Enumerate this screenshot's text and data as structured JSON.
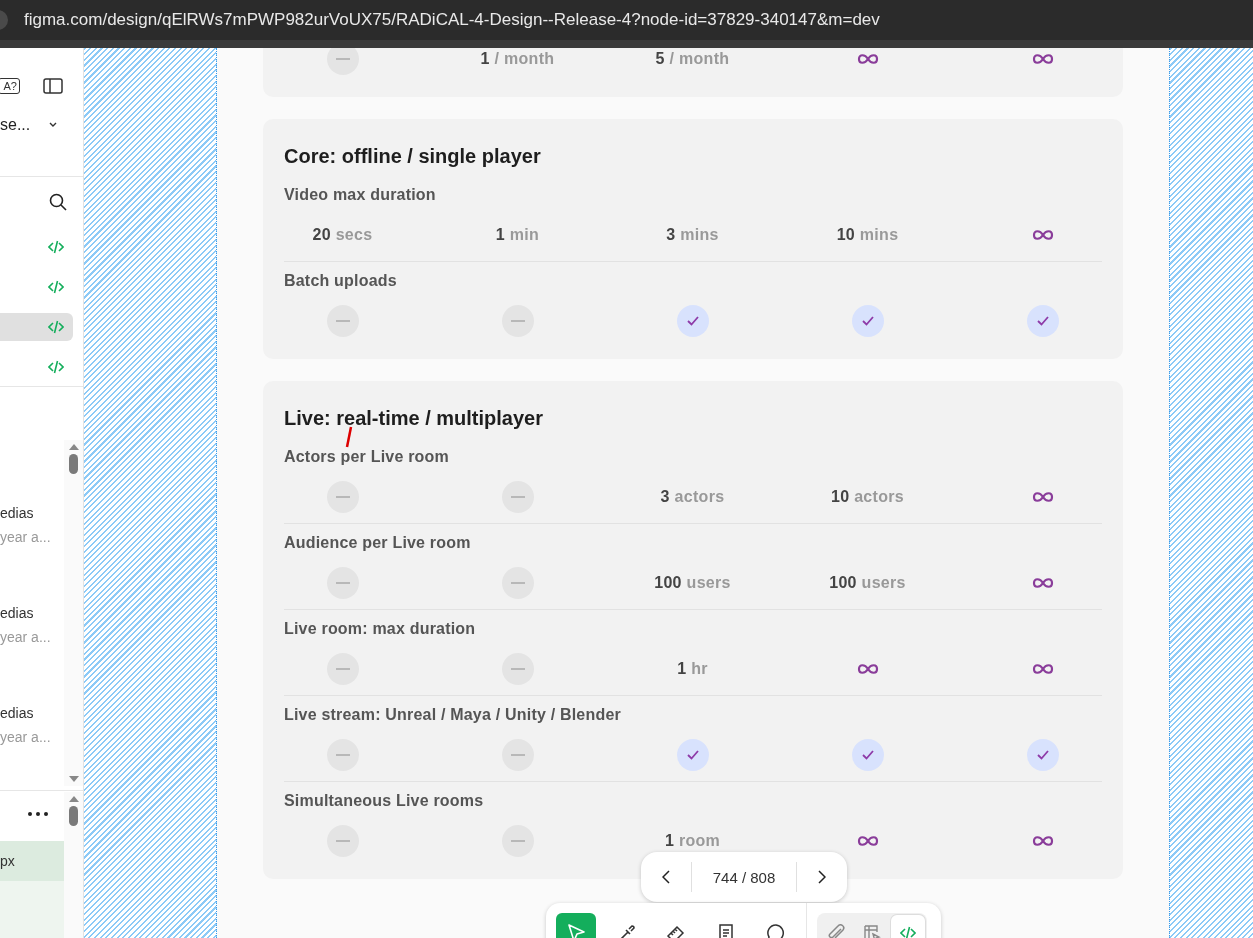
{
  "browser": {
    "url": "figma.com/design/qElRWs7mPWP982urVoUX75/RADiCAL-4-Design--Release-4?node-id=37829-340147&m=dev"
  },
  "sidebar": {
    "badge": "A?",
    "file_name": "se...",
    "code_items": [
      {
        "selected": false
      },
      {
        "selected": false
      },
      {
        "selected": true
      },
      {
        "selected": false
      }
    ],
    "list_items": [
      {
        "title": "edias",
        "subtitle": "year a..."
      },
      {
        "title": "edias",
        "subtitle": "year a..."
      },
      {
        "title": "edias",
        "subtitle": "year a..."
      }
    ],
    "property_value": "px"
  },
  "sections": [
    {
      "rows": [
        {
          "cells": [
            {
              "kind": "none"
            },
            {
              "kind": "text",
              "value": "1",
              "unit": "/ month"
            },
            {
              "kind": "text",
              "value": "5",
              "unit": "/ month"
            },
            {
              "kind": "unlimited"
            },
            {
              "kind": "unlimited"
            }
          ]
        }
      ]
    },
    {
      "title": "Core: offline / single player",
      "rows": [
        {
          "label": "Video max duration",
          "cells": [
            {
              "kind": "text",
              "value": "20",
              "unit": "secs"
            },
            {
              "kind": "text",
              "value": "1",
              "unit": "min"
            },
            {
              "kind": "text",
              "value": "3",
              "unit": "mins"
            },
            {
              "kind": "text",
              "value": "10",
              "unit": "mins"
            },
            {
              "kind": "unlimited"
            }
          ]
        },
        {
          "label": "Batch uploads",
          "cells": [
            {
              "kind": "none"
            },
            {
              "kind": "none"
            },
            {
              "kind": "check"
            },
            {
              "kind": "check"
            },
            {
              "kind": "check"
            }
          ]
        }
      ]
    },
    {
      "title": "Live: real-time / multiplayer",
      "rows": [
        {
          "label": "Actors per Live room",
          "cells": [
            {
              "kind": "none"
            },
            {
              "kind": "none"
            },
            {
              "kind": "text",
              "value": "3",
              "unit": "actors"
            },
            {
              "kind": "text",
              "value": "10",
              "unit": "actors"
            },
            {
              "kind": "unlimited"
            }
          ]
        },
        {
          "label": "Audience per Live room",
          "cells": [
            {
              "kind": "none"
            },
            {
              "kind": "none"
            },
            {
              "kind": "text",
              "value": "100",
              "unit": "users"
            },
            {
              "kind": "text",
              "value": "100",
              "unit": "users"
            },
            {
              "kind": "unlimited"
            }
          ]
        },
        {
          "label": "Live room: max duration",
          "cells": [
            {
              "kind": "none"
            },
            {
              "kind": "none"
            },
            {
              "kind": "text",
              "value": "1",
              "unit": "hr"
            },
            {
              "kind": "unlimited"
            },
            {
              "kind": "unlimited"
            }
          ]
        },
        {
          "label": "Live stream: Unreal / Maya / Unity / Blender",
          "cells": [
            {
              "kind": "none"
            },
            {
              "kind": "none"
            },
            {
              "kind": "check"
            },
            {
              "kind": "check"
            },
            {
              "kind": "check"
            }
          ]
        },
        {
          "label": "Simultaneous Live rooms",
          "cells": [
            {
              "kind": "none"
            },
            {
              "kind": "none"
            },
            {
              "kind": "text",
              "value": "1",
              "unit": "room"
            },
            {
              "kind": "unlimited"
            },
            {
              "kind": "unlimited"
            }
          ]
        }
      ]
    }
  ],
  "pager": {
    "position": "744 / 808"
  },
  "toolbar": {
    "tools": [
      {
        "kind": "move",
        "selected": true
      },
      {
        "kind": "dropper",
        "selected": false
      },
      {
        "kind": "ruler",
        "selected": false
      },
      {
        "kind": "note",
        "selected": false
      },
      {
        "kind": "comment",
        "selected": false
      }
    ],
    "modes": [
      {
        "kind": "link",
        "selected": false
      },
      {
        "kind": "inspect",
        "selected": false
      },
      {
        "kind": "code",
        "selected": true
      }
    ]
  }
}
